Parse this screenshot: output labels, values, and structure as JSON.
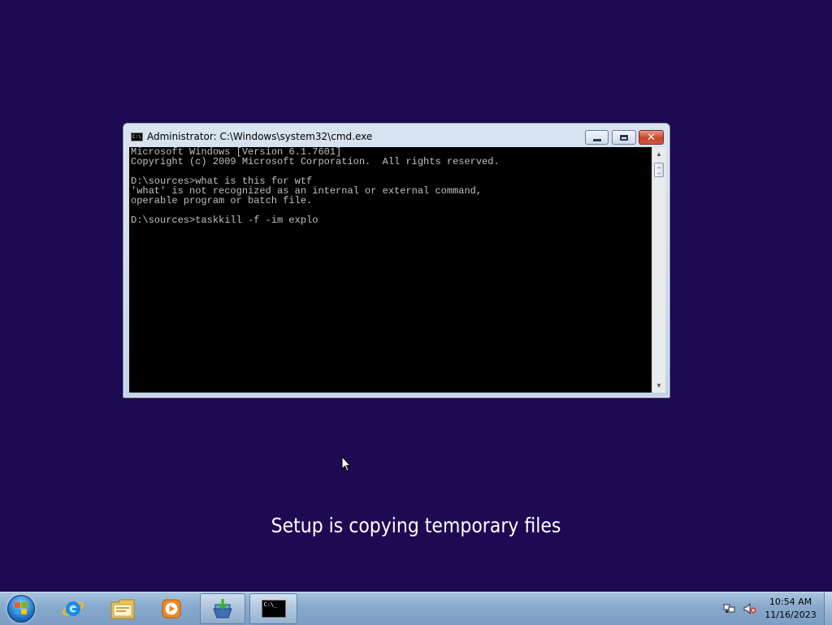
{
  "window": {
    "title": "Administrator: C:\\Windows\\system32\\cmd.exe",
    "icon_text": "C:\\",
    "console_lines": [
      "Microsoft Windows [Version 6.1.7601]",
      "Copyright (c) 2009 Microsoft Corporation.  All rights reserved.",
      "",
      "D:\\sources>what is this for wtf",
      "'what' is not recognized as an internal or external command,",
      "operable program or batch file.",
      "",
      "D:\\sources>taskkill -f -im explo"
    ]
  },
  "setup": {
    "status": "Setup is copying temporary files"
  },
  "taskbar": {
    "items": [
      {
        "name": "internet-explorer"
      },
      {
        "name": "file-explorer"
      },
      {
        "name": "media-player"
      },
      {
        "name": "setup-installer"
      },
      {
        "name": "command-prompt",
        "icon_text": "C:\\_"
      }
    ]
  },
  "tray": {
    "time": "10:54 AM",
    "date": "11/16/2023"
  },
  "colors": {
    "desktop": "#1e0a52",
    "console_bg": "#000000",
    "console_text": "#c0c0c0",
    "taskbar": "#87a9cc",
    "close_button": "#c9442b"
  }
}
